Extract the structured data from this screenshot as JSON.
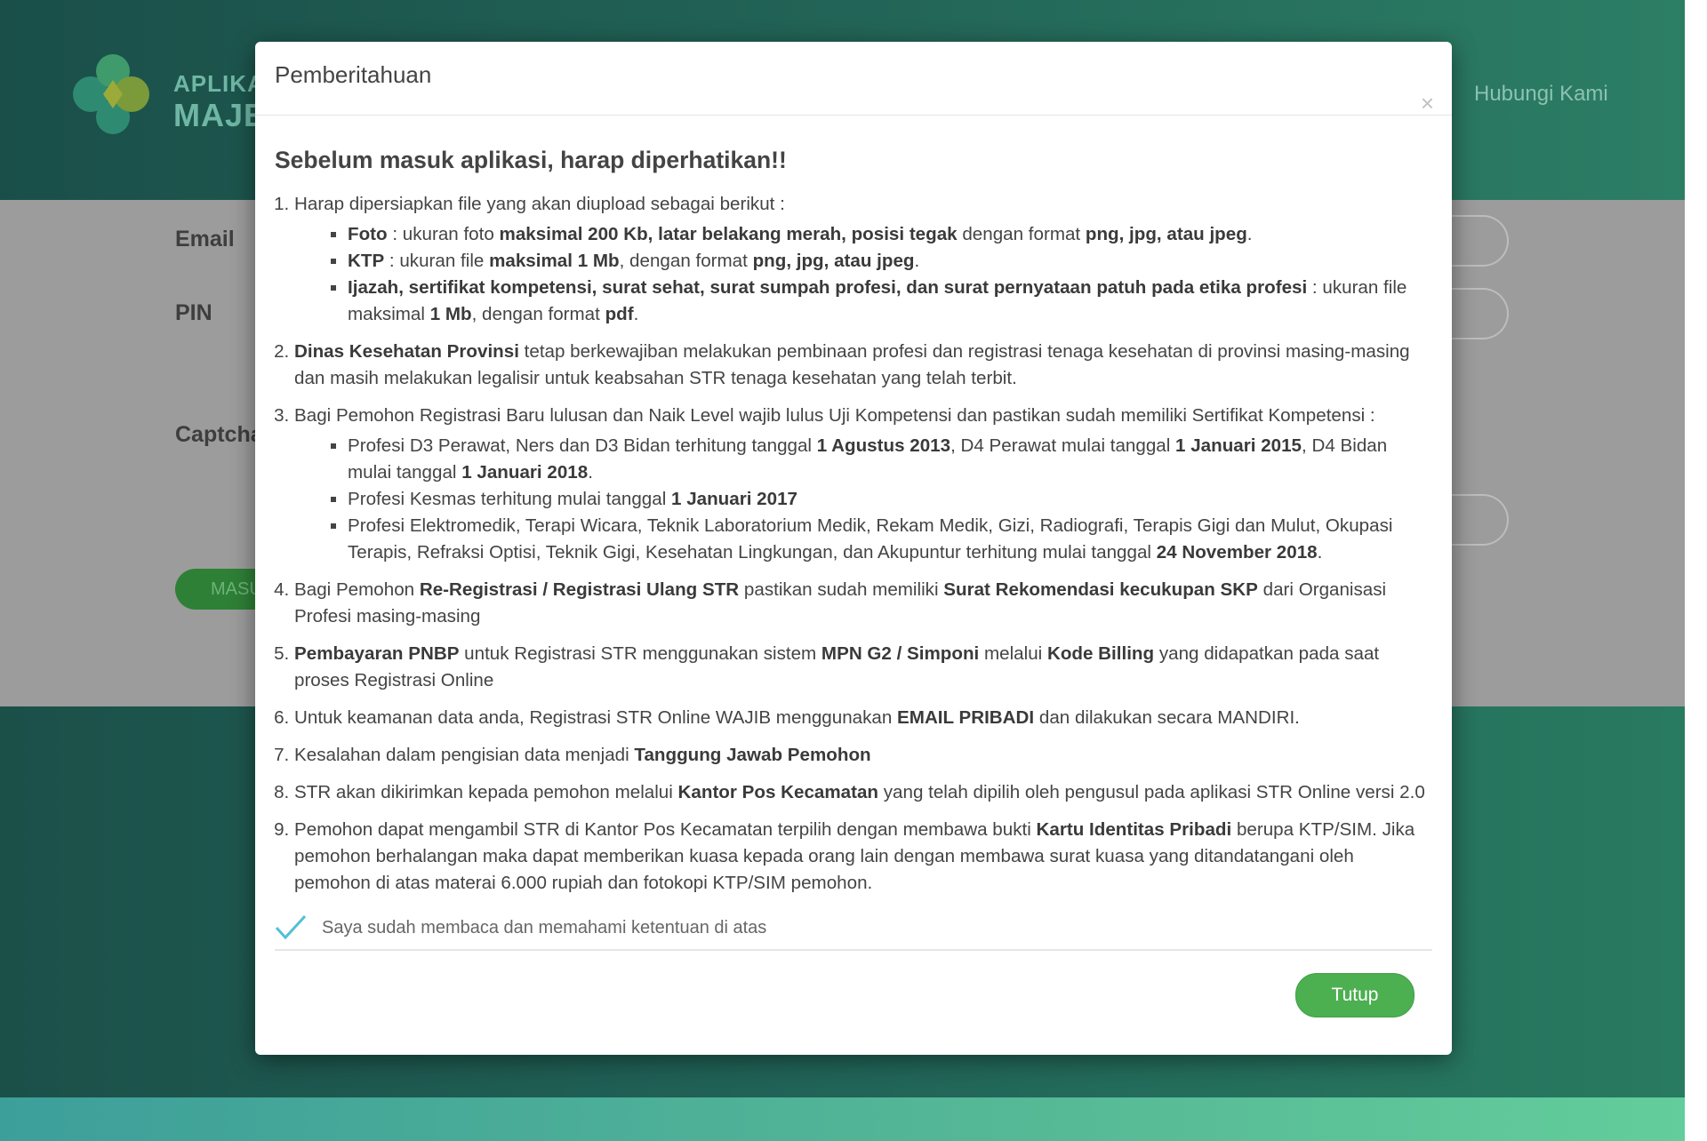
{
  "background": {
    "brand_line1": "APLIKAS",
    "brand_line2": "MAJEL",
    "nav": {
      "contact": "Hubungi Kami"
    },
    "form": {
      "email_label": "Email",
      "pin_label": "PIN",
      "captcha_label": "Captcha",
      "login_button": "MASU"
    }
  },
  "modal": {
    "title": "Pemberitahuan",
    "close_glyph": "×",
    "heading": "Sebelum masuk aplikasi, harap diperhatikan!!",
    "items": {
      "i1": {
        "intro": "Harap dipersiapkan file yang akan diupload sebagai berikut :",
        "foto": {
          "k": "Foto",
          "t1": " : ukuran foto ",
          "b1": "maksimal 200 Kb, latar belakang merah, posisi tegak",
          "t2": " dengan format ",
          "b2": "png, jpg, atau jpeg",
          "t3": "."
        },
        "ktp": {
          "k": "KTP",
          "t1": " : ukuran file ",
          "b1": "maksimal 1 Mb",
          "t2": ", dengan format ",
          "b2": "png, jpg, atau jpeg",
          "t3": "."
        },
        "ijazah": {
          "k": "Ijazah, sertifikat kompetensi, surat sehat, surat sumpah profesi, dan surat pernyataan patuh pada etika profesi",
          "t1": " : ukuran file maksimal ",
          "b1": "1 Mb",
          "t2": ", dengan format ",
          "b2": "pdf",
          "t3": "."
        }
      },
      "i2": {
        "b1": "Dinas Kesehatan Provinsi",
        "t1": " tetap berkewajiban melakukan pembinaan profesi dan registrasi tenaga kesehatan di provinsi masing-masing dan masih melakukan legalisir untuk keabsahan STR tenaga kesehatan yang telah terbit."
      },
      "i3": {
        "intro": "Bagi Pemohon Registrasi Baru lulusan dan Naik Level wajib lulus Uji Kompetensi dan pastikan sudah memiliki Sertifikat Kompetensi :",
        "s1": {
          "t1": "Profesi D3 Perawat, Ners dan D3 Bidan terhitung tanggal ",
          "b1": "1 Agustus 2013",
          "t2": ", D4 Perawat mulai tanggal ",
          "b2": "1 Januari 2015",
          "t3": ", D4 Bidan mulai tanggal ",
          "b3": "1 Januari 2018",
          "t4": "."
        },
        "s2": {
          "t1": "Profesi Kesmas terhitung mulai tanggal ",
          "b1": "1 Januari 2017"
        },
        "s3": {
          "t1": "Profesi Elektromedik, Terapi Wicara, Teknik Laboratorium Medik, Rekam Medik, Gizi, Radiografi, Terapis Gigi dan Mulut, Okupasi Terapis, Refraksi Optisi, Teknik Gigi, Kesehatan Lingkungan, dan Akupuntur terhitung mulai tanggal ",
          "b1": "24 November 2018",
          "t2": "."
        }
      },
      "i4": {
        "t1": "Bagi Pemohon ",
        "b1": "Re-Registrasi / Registrasi Ulang STR",
        "t2": " pastikan sudah memiliki ",
        "b2": "Surat Rekomendasi kecukupan SKP",
        "t3": " dari Organisasi Profesi masing-masing"
      },
      "i5": {
        "b1": "Pembayaran PNBP",
        "t1": " untuk Registrasi STR menggunakan sistem ",
        "b2": "MPN G2 / Simponi",
        "t2": " melalui ",
        "b3": "Kode Billing",
        "t3": " yang didapatkan pada saat proses Registrasi Online"
      },
      "i6": {
        "t1": "Untuk keamanan data anda, Registrasi STR Online WAJIB menggunakan ",
        "b1": "EMAIL PRIBADI",
        "t2": " dan dilakukan secara MANDIRI."
      },
      "i7": {
        "t1": "Kesalahan dalam pengisian data menjadi ",
        "b1": "Tanggung Jawab Pemohon"
      },
      "i8": {
        "t1": "STR akan dikirimkan kepada pemohon melalui ",
        "b1": "Kantor Pos Kecamatan",
        "t2": " yang telah dipilih oleh pengusul pada aplikasi STR Online versi 2.0"
      },
      "i9": {
        "t1": "Pemohon dapat mengambil STR di Kantor Pos Kecamatan terpilih dengan membawa bukti ",
        "b1": "Kartu Identitas Pribadi",
        "t2": " berupa KTP/SIM. Jika pemohon berhalangan maka dapat memberikan kuasa kepada orang lain dengan membawa surat kuasa yang ditandatangani oleh pemohon di atas materai 6.000 rupiah dan fotokopi KTP/SIM pemohon."
      }
    },
    "agreement": "Saya sudah membaca dan memahami ketentuan di atas",
    "agreement_checked": true,
    "close_button": "Tutup"
  },
  "colors": {
    "header_green": "#226457",
    "button_green": "#4caf50",
    "check_color": "#4fc0d8",
    "overlay_gray": "#9c9c9c"
  },
  "icons": [
    "logo-icon",
    "close-icon",
    "check-icon"
  ]
}
